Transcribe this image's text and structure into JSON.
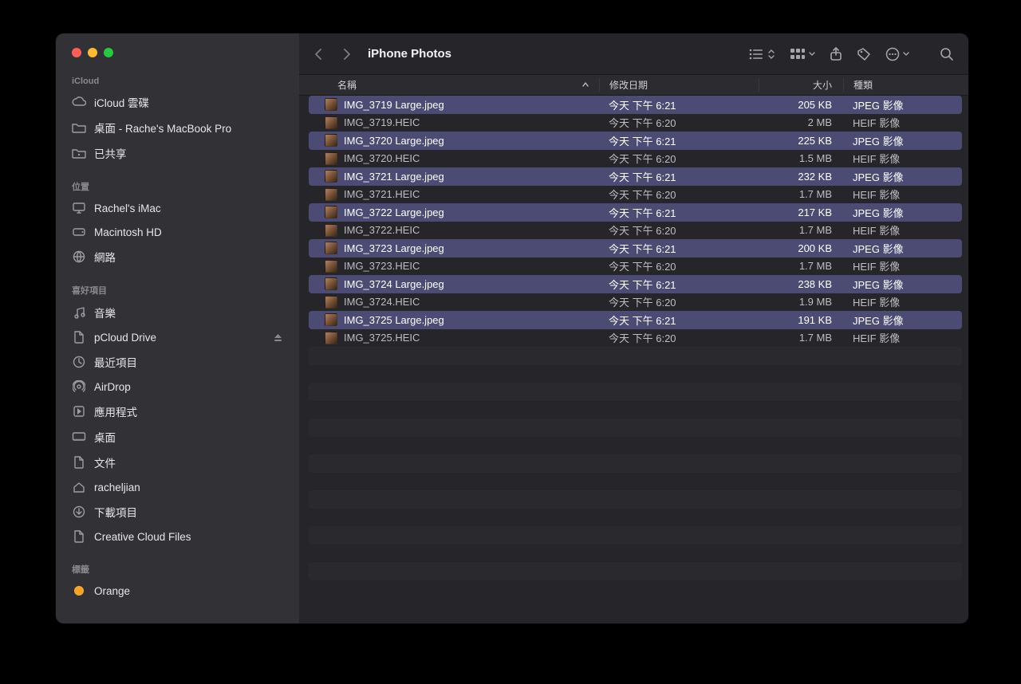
{
  "window": {
    "title": "iPhone Photos"
  },
  "sidebar": {
    "sections": [
      {
        "label": "iCloud",
        "items": [
          {
            "icon": "cloud",
            "label": "iCloud 雲碟"
          },
          {
            "icon": "folder",
            "label": "桌面 - Rache's MacBook Pro"
          },
          {
            "icon": "shared",
            "label": "已共享"
          }
        ]
      },
      {
        "label": "位置",
        "items": [
          {
            "icon": "imac",
            "label": "Rachel's iMac"
          },
          {
            "icon": "disk",
            "label": "Macintosh HD"
          },
          {
            "icon": "globe",
            "label": "網路"
          }
        ]
      },
      {
        "label": "喜好項目",
        "items": [
          {
            "icon": "music",
            "label": "音樂"
          },
          {
            "icon": "doc",
            "label": "pCloud Drive",
            "eject": true
          },
          {
            "icon": "clock",
            "label": "最近項目"
          },
          {
            "icon": "airdrop",
            "label": "AirDrop"
          },
          {
            "icon": "apps",
            "label": "應用程式"
          },
          {
            "icon": "desktop",
            "label": "桌面"
          },
          {
            "icon": "doc",
            "label": "文件"
          },
          {
            "icon": "home",
            "label": "racheljian"
          },
          {
            "icon": "download",
            "label": "下載項目"
          },
          {
            "icon": "doc",
            "label": "Creative Cloud Files"
          }
        ]
      },
      {
        "label": "標籤",
        "items": [
          {
            "icon": "tag",
            "label": "Orange",
            "tagColor": "#f6a322"
          }
        ]
      }
    ]
  },
  "columns": {
    "name": "名稱",
    "date": "修改日期",
    "size": "大小",
    "kind": "種類"
  },
  "files": [
    {
      "name": "IMG_3719 Large.jpeg",
      "date": "今天 下午 6:21",
      "size": "205 KB",
      "kind": "JPEG 影像",
      "selected": true
    },
    {
      "name": "IMG_3719.HEIC",
      "date": "今天 下午 6:20",
      "size": "2 MB",
      "kind": "HEIF 影像",
      "selected": false
    },
    {
      "name": "IMG_3720 Large.jpeg",
      "date": "今天 下午 6:21",
      "size": "225 KB",
      "kind": "JPEG 影像",
      "selected": true
    },
    {
      "name": "IMG_3720.HEIC",
      "date": "今天 下午 6:20",
      "size": "1.5 MB",
      "kind": "HEIF 影像",
      "selected": false
    },
    {
      "name": "IMG_3721 Large.jpeg",
      "date": "今天 下午 6:21",
      "size": "232 KB",
      "kind": "JPEG 影像",
      "selected": true
    },
    {
      "name": "IMG_3721.HEIC",
      "date": "今天 下午 6:20",
      "size": "1.7 MB",
      "kind": "HEIF 影像",
      "selected": false
    },
    {
      "name": "IMG_3722 Large.jpeg",
      "date": "今天 下午 6:21",
      "size": "217 KB",
      "kind": "JPEG 影像",
      "selected": true
    },
    {
      "name": "IMG_3722.HEIC",
      "date": "今天 下午 6:20",
      "size": "1.7 MB",
      "kind": "HEIF 影像",
      "selected": false
    },
    {
      "name": "IMG_3723 Large.jpeg",
      "date": "今天 下午 6:21",
      "size": "200 KB",
      "kind": "JPEG 影像",
      "selected": true
    },
    {
      "name": "IMG_3723.HEIC",
      "date": "今天 下午 6:20",
      "size": "1.7 MB",
      "kind": "HEIF 影像",
      "selected": false
    },
    {
      "name": "IMG_3724 Large.jpeg",
      "date": "今天 下午 6:21",
      "size": "238 KB",
      "kind": "JPEG 影像",
      "selected": true
    },
    {
      "name": "IMG_3724.HEIC",
      "date": "今天 下午 6:20",
      "size": "1.9 MB",
      "kind": "HEIF 影像",
      "selected": false
    },
    {
      "name": "IMG_3725 Large.jpeg",
      "date": "今天 下午 6:21",
      "size": "191 KB",
      "kind": "JPEG 影像",
      "selected": true
    },
    {
      "name": "IMG_3725.HEIC",
      "date": "今天 下午 6:20",
      "size": "1.7 MB",
      "kind": "HEIF 影像",
      "selected": false
    }
  ],
  "emptyRows": 13
}
